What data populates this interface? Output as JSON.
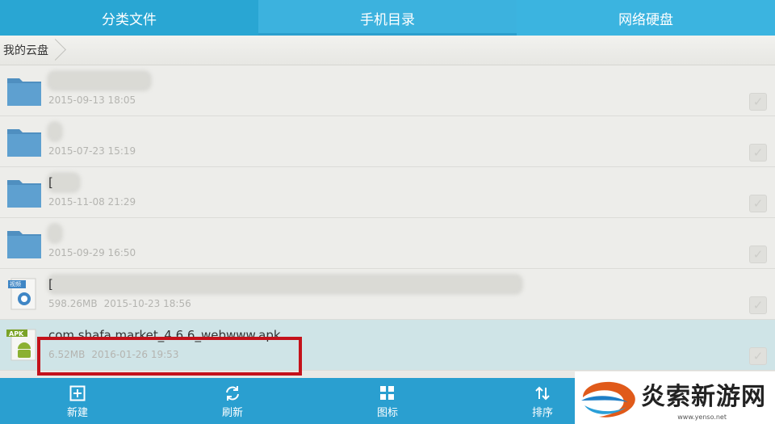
{
  "tabs": [
    {
      "label": "分类文件"
    },
    {
      "label": "手机目录",
      "active": true
    },
    {
      "label": "网络硬盘"
    }
  ],
  "breadcrumb": {
    "root": "我的云盘"
  },
  "files": [
    {
      "type": "folder",
      "name": "",
      "date": "2015-09-13 18:05",
      "size": ""
    },
    {
      "type": "folder",
      "name": "",
      "date": "2015-07-23 15:19",
      "size": ""
    },
    {
      "type": "folder",
      "name": "[",
      "date": "2015-11-08 21:29",
      "size": ""
    },
    {
      "type": "folder",
      "name": "",
      "date": "2015-09-29 16:50",
      "size": ""
    },
    {
      "type": "video",
      "name": "[",
      "date": "2015-10-23 18:56",
      "size": "598.26MB",
      "badge": "视频"
    },
    {
      "type": "apk",
      "name": "com.shafa.market_4.6.6_webwww.apk",
      "date": "2016-01-26 19:53",
      "size": "6.52MB",
      "badge": "APK",
      "selected": true
    }
  ],
  "toolbar": [
    {
      "label": "新建",
      "icon": "plus-box-icon"
    },
    {
      "label": "刷新",
      "icon": "refresh-icon"
    },
    {
      "label": "图标",
      "icon": "grid-icon"
    },
    {
      "label": "排序",
      "icon": "sort-icon"
    }
  ],
  "watermark": {
    "text": "炎索新游网",
    "url": "www.yenso.net"
  },
  "colors": {
    "accent": "#29a6d3",
    "highlight": "#c4121b",
    "selected_row": "#cfe4e7"
  }
}
